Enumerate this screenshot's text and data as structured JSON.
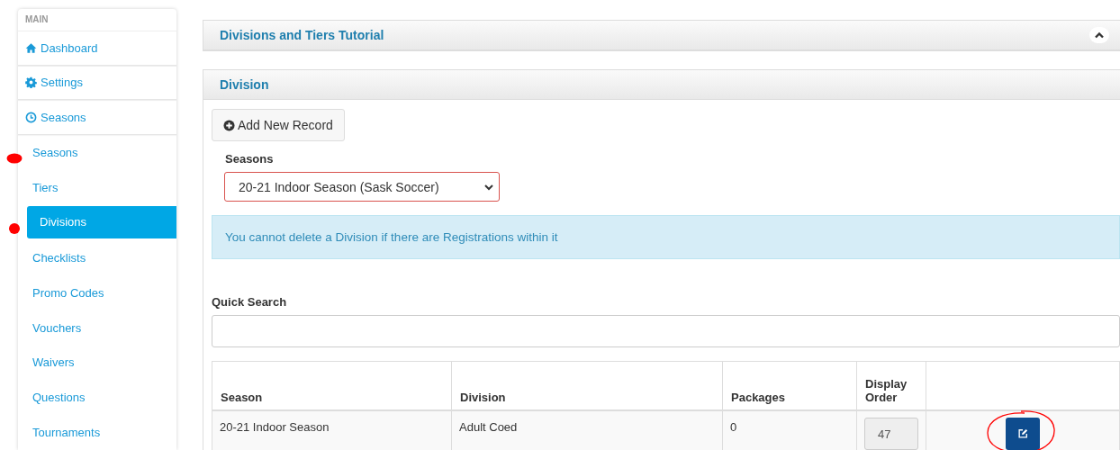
{
  "sidebar": {
    "heading": "MAIN",
    "items": [
      {
        "label": "Dashboard",
        "kind": "group",
        "selected": false
      },
      {
        "label": "Settings",
        "kind": "group",
        "selected": false
      },
      {
        "label": "Seasons",
        "kind": "group",
        "selected": false
      },
      {
        "label": "Seasons",
        "kind": "sub",
        "selected": false
      },
      {
        "label": "Tiers",
        "kind": "sub",
        "selected": false
      },
      {
        "label": "Divisions",
        "kind": "sub",
        "selected": true
      },
      {
        "label": "Checklists",
        "kind": "sub",
        "selected": false
      },
      {
        "label": "Promo Codes",
        "kind": "sub",
        "selected": false
      },
      {
        "label": "Vouchers",
        "kind": "sub",
        "selected": false
      },
      {
        "label": "Waivers",
        "kind": "sub",
        "selected": false
      },
      {
        "label": "Questions",
        "kind": "sub",
        "selected": false
      },
      {
        "label": "Tournaments",
        "kind": "sub",
        "selected": false
      }
    ]
  },
  "tutorial_panel": {
    "title": "Divisions and Tiers Tutorial",
    "expanded": true
  },
  "division_panel": {
    "title": "Division",
    "add_button": "Add New Record",
    "seasons_label": "Seasons",
    "seasons_select": "20-21 Indoor Season (Sask Soccer)",
    "alert": "You cannot delete a Division if there are Registrations within it",
    "quick_search_label": "Quick Search",
    "table": {
      "columns": [
        "Season",
        "Division",
        "Packages",
        "Display Order"
      ],
      "rows": [
        {
          "season": "20-21 Indoor Season",
          "division": "Adult Coed",
          "packages": "0",
          "display_order": "47"
        }
      ]
    }
  }
}
